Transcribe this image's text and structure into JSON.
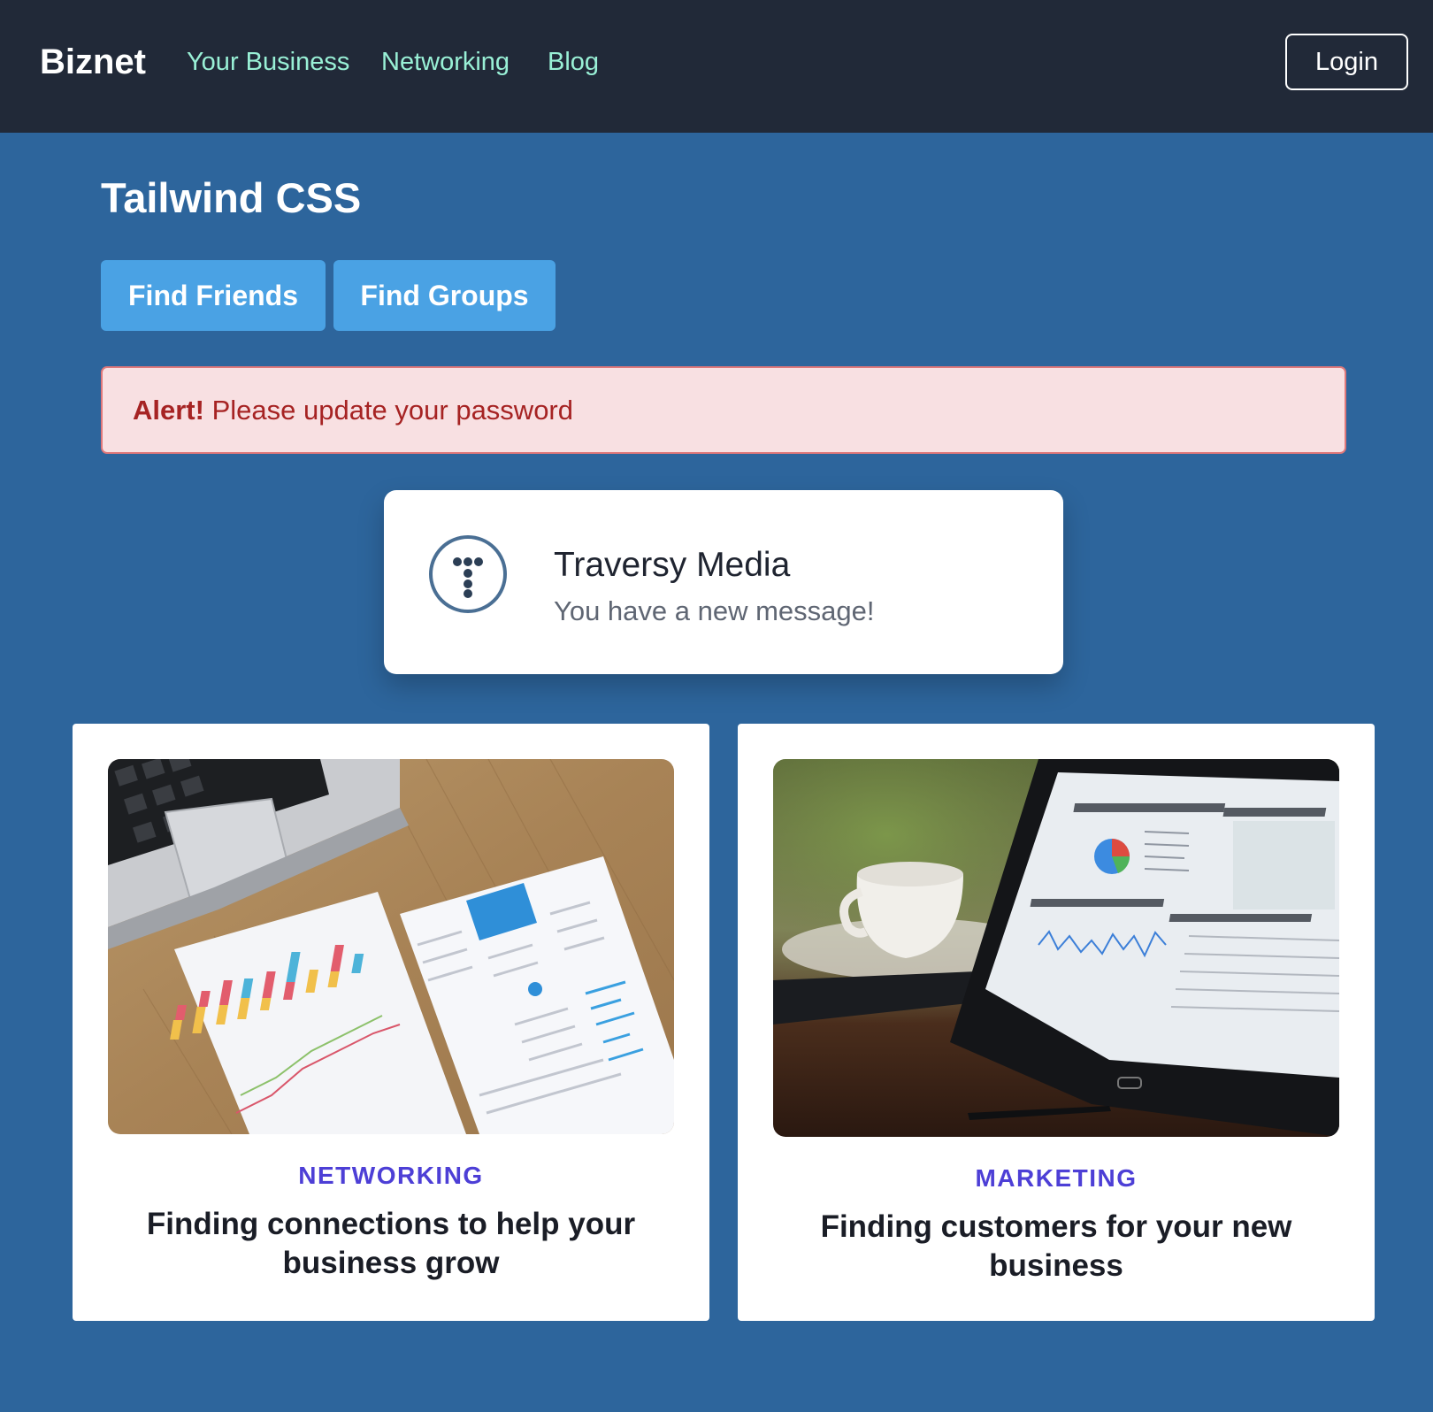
{
  "nav": {
    "brand": "Biznet",
    "links": [
      "Your Business",
      "Networking",
      "Blog"
    ],
    "login": "Login"
  },
  "hero": {
    "title": "Tailwind CSS",
    "buttons": [
      "Find Friends",
      "Find Groups"
    ]
  },
  "alert": {
    "strong": "Alert!",
    "message": "Please update your password"
  },
  "notification": {
    "title": "Traversy Media",
    "message": "You have a new message!"
  },
  "cards": [
    {
      "tag": "NETWORKING",
      "title": "Finding connections to help your business grow",
      "image": "desk-report-photo"
    },
    {
      "tag": "MARKETING",
      "title": "Finding customers for your new business",
      "image": "tablet-analytics-photo"
    }
  ],
  "colors": {
    "page_bg": "#2d659c",
    "nav_bg": "#212938",
    "nav_link": "#99f0d6",
    "button": "#4aa2e4",
    "alert_bg": "#f8e0e2",
    "alert_text": "#a62323",
    "tag": "#4d3fd6"
  }
}
